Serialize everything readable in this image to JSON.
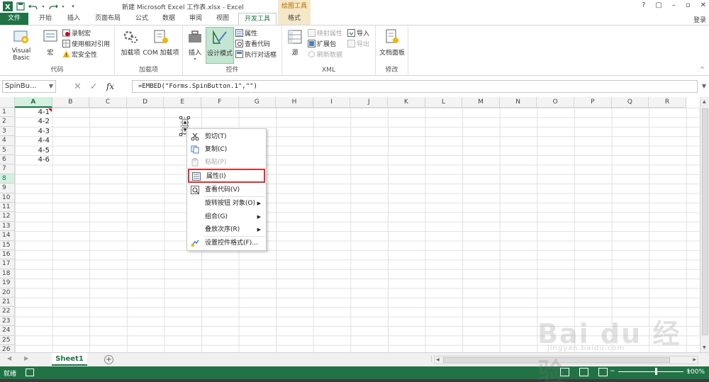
{
  "titlebar": {
    "title": "新建 Microsoft Excel 工作表.xlsx - Excel",
    "context_tab": "绘图工具",
    "help": "?",
    "win_controls": [
      "▢",
      "–",
      "▫",
      "✕"
    ]
  },
  "tabs": {
    "file": "文件",
    "items": [
      "开始",
      "插入",
      "页面布局",
      "公式",
      "数据",
      "审阅",
      "视图"
    ],
    "active": "开发工具",
    "format": "格式",
    "login": "登录"
  },
  "ribbon": {
    "code": {
      "label": "代码",
      "visual_basic": "Visual Basic",
      "macros": "宏",
      "record_macro": "录制宏",
      "relative_ref": "使用相对引用",
      "macro_security": "宏安全性"
    },
    "addins": {
      "label": "加载项",
      "addins": "加载项",
      "com": "COM 加载项"
    },
    "controls": {
      "label": "控件",
      "insert": "插入",
      "design_mode": "设计模式",
      "properties": "属性",
      "view_code": "查看代码",
      "run_dialog": "执行对话框"
    },
    "xml": {
      "label": "XML",
      "source": "源",
      "map_props": "映射属性",
      "expansion": "扩展包",
      "refresh": "刷新数据",
      "import": "导入",
      "export": "导出"
    },
    "modify": {
      "label": "修改",
      "doc_panel": "文档面板"
    }
  },
  "formula_bar": {
    "name_box": "SpinBu...",
    "fx": "fx",
    "formula": "=EMBED(\"Forms.SpinButton.1\",\"\")"
  },
  "grid": {
    "columns": [
      "A",
      "B",
      "C",
      "D",
      "E",
      "F",
      "G",
      "H",
      "I",
      "J",
      "K",
      "L",
      "M",
      "N",
      "O",
      "P",
      "Q",
      "R"
    ],
    "rows": [
      "1",
      "2",
      "3",
      "4",
      "5",
      "6",
      "7",
      "8",
      "9",
      "10",
      "11",
      "12",
      "13",
      "14",
      "15",
      "16",
      "17",
      "18",
      "19",
      "20",
      "21",
      "22",
      "23",
      "24",
      "25",
      "26"
    ],
    "cells_a": [
      "4-1",
      "4-2",
      "4-3",
      "4-4",
      "4-5",
      "4-6"
    ]
  },
  "context_menu": {
    "cut": "剪切(T)",
    "copy": "复制(C)",
    "paste": "粘贴(P)",
    "properties": "属性(I)",
    "view_code": "查看代码(V)",
    "spin_object": "旋转按钮 对象(O)",
    "group": "组合(G)",
    "order": "叠放次序(R)",
    "format_control": "设置控件格式(F)..."
  },
  "sheets": {
    "active": "Sheet1",
    "add": "+"
  },
  "status": {
    "ready": "就绪",
    "zoom_minus": "−",
    "zoom_plus": "+",
    "zoom": "100%"
  },
  "colors": {
    "excel_green": "#217346",
    "highlight_red": "#e03030"
  },
  "watermark": {
    "text": "Bai du 经验",
    "url": "jingyan.baidu.com"
  }
}
